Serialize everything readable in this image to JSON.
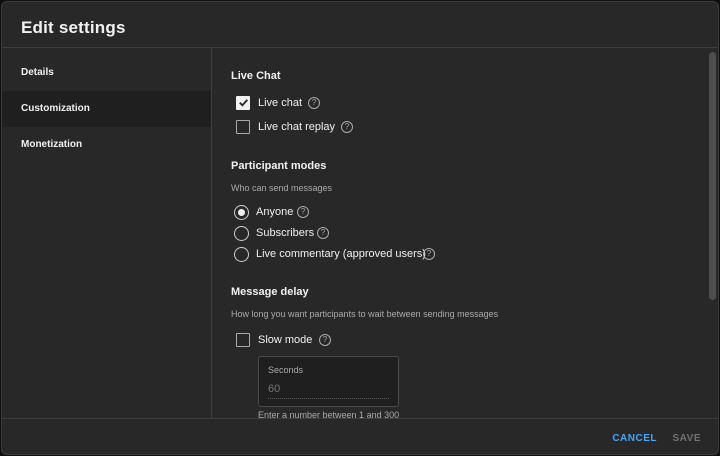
{
  "header": {
    "title": "Edit settings"
  },
  "sidebar": {
    "items": [
      {
        "label": "Details"
      },
      {
        "label": "Customization"
      },
      {
        "label": "Monetization"
      }
    ]
  },
  "live_chat": {
    "title": "Live Chat",
    "options": [
      {
        "label": "Live chat",
        "checked": true
      },
      {
        "label": "Live chat replay",
        "checked": false
      }
    ]
  },
  "participant_modes": {
    "title": "Participant modes",
    "subtitle": "Who can send messages",
    "options": [
      {
        "label": "Anyone",
        "selected": true
      },
      {
        "label": "Subscribers",
        "selected": false
      },
      {
        "label": "Live commentary (approved users)",
        "selected": false
      }
    ]
  },
  "message_delay": {
    "title": "Message delay",
    "subtitle": "How long you want participants to wait between sending messages",
    "slow_mode": {
      "label": "Slow mode",
      "checked": false
    },
    "seconds": {
      "label": "Seconds",
      "placeholder": "60",
      "hint": "Enter a number between 1 and 300"
    }
  },
  "help_glyph": "?",
  "footer": {
    "cancel": "CANCEL",
    "save": "SAVE"
  }
}
